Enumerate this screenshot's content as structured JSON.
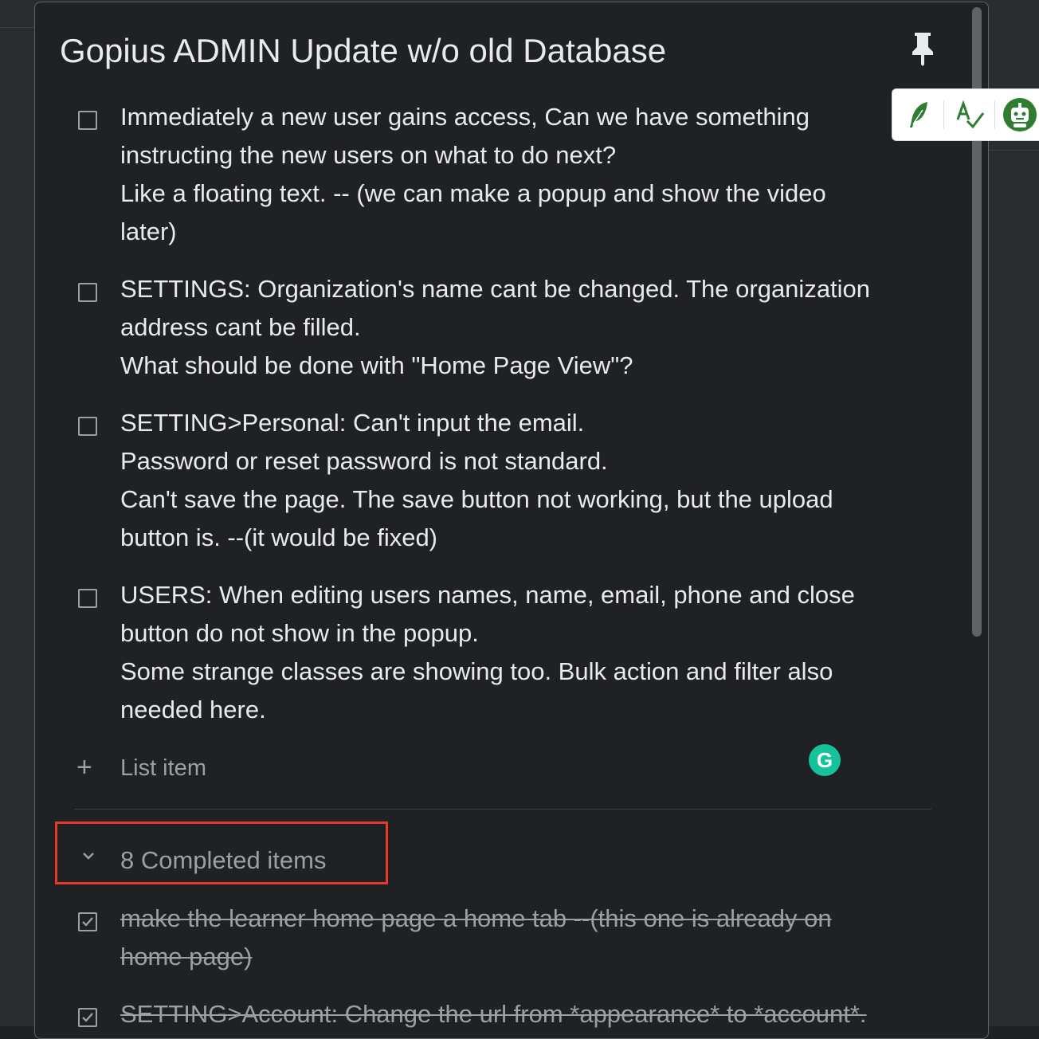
{
  "note": {
    "title": "Gopius ADMIN Update w/o old Database"
  },
  "items": [
    {
      "text": "Immediately a new user gains access, Can we have something\ninstructing the new users on what to do next?\nLike a floating text.  -- (we can make a popup and show the video\nlater)",
      "checked": false
    },
    {
      "text": "SETTINGS: Organization's name cant be changed. The organization\naddress cant be filled.\nWhat should be done with \"Home Page View\"?",
      "checked": false
    },
    {
      "text": "SETTING>Personal: Can't input the email.\nPassword or reset password is not standard.\nCan't save the page. The save button not working, but the upload\nbutton is. --(it would be fixed)",
      "checked": false
    },
    {
      "text": "USERS: When editing users names, name, email, phone and close\nbutton do not show in the popup.\nSome strange classes are showing too. Bulk action and filter also\nneeded here.",
      "checked": false
    }
  ],
  "add_item": {
    "label": "List item"
  },
  "grammarly": {
    "label": "G"
  },
  "completed": {
    "label": "8 Completed items",
    "items": [
      {
        "text": "make the learner home page a home tab --(this one is already on\nhome page)",
        "checked": true
      },
      {
        "text": "SETTING>Account: Change the url from *appearance* to *account*.",
        "checked": true
      }
    ]
  },
  "colors": {
    "background": "#202124",
    "text": "#e8eaed",
    "muted": "#9aa0a6",
    "highlight": "#e53a2a",
    "grammarly": "#15c39a"
  },
  "icons": [
    "pin-icon",
    "checkbox-icon",
    "plus-icon",
    "chevron-down-icon",
    "grammarly-icon",
    "quill-icon",
    "spellcheck-icon",
    "robot-icon"
  ]
}
